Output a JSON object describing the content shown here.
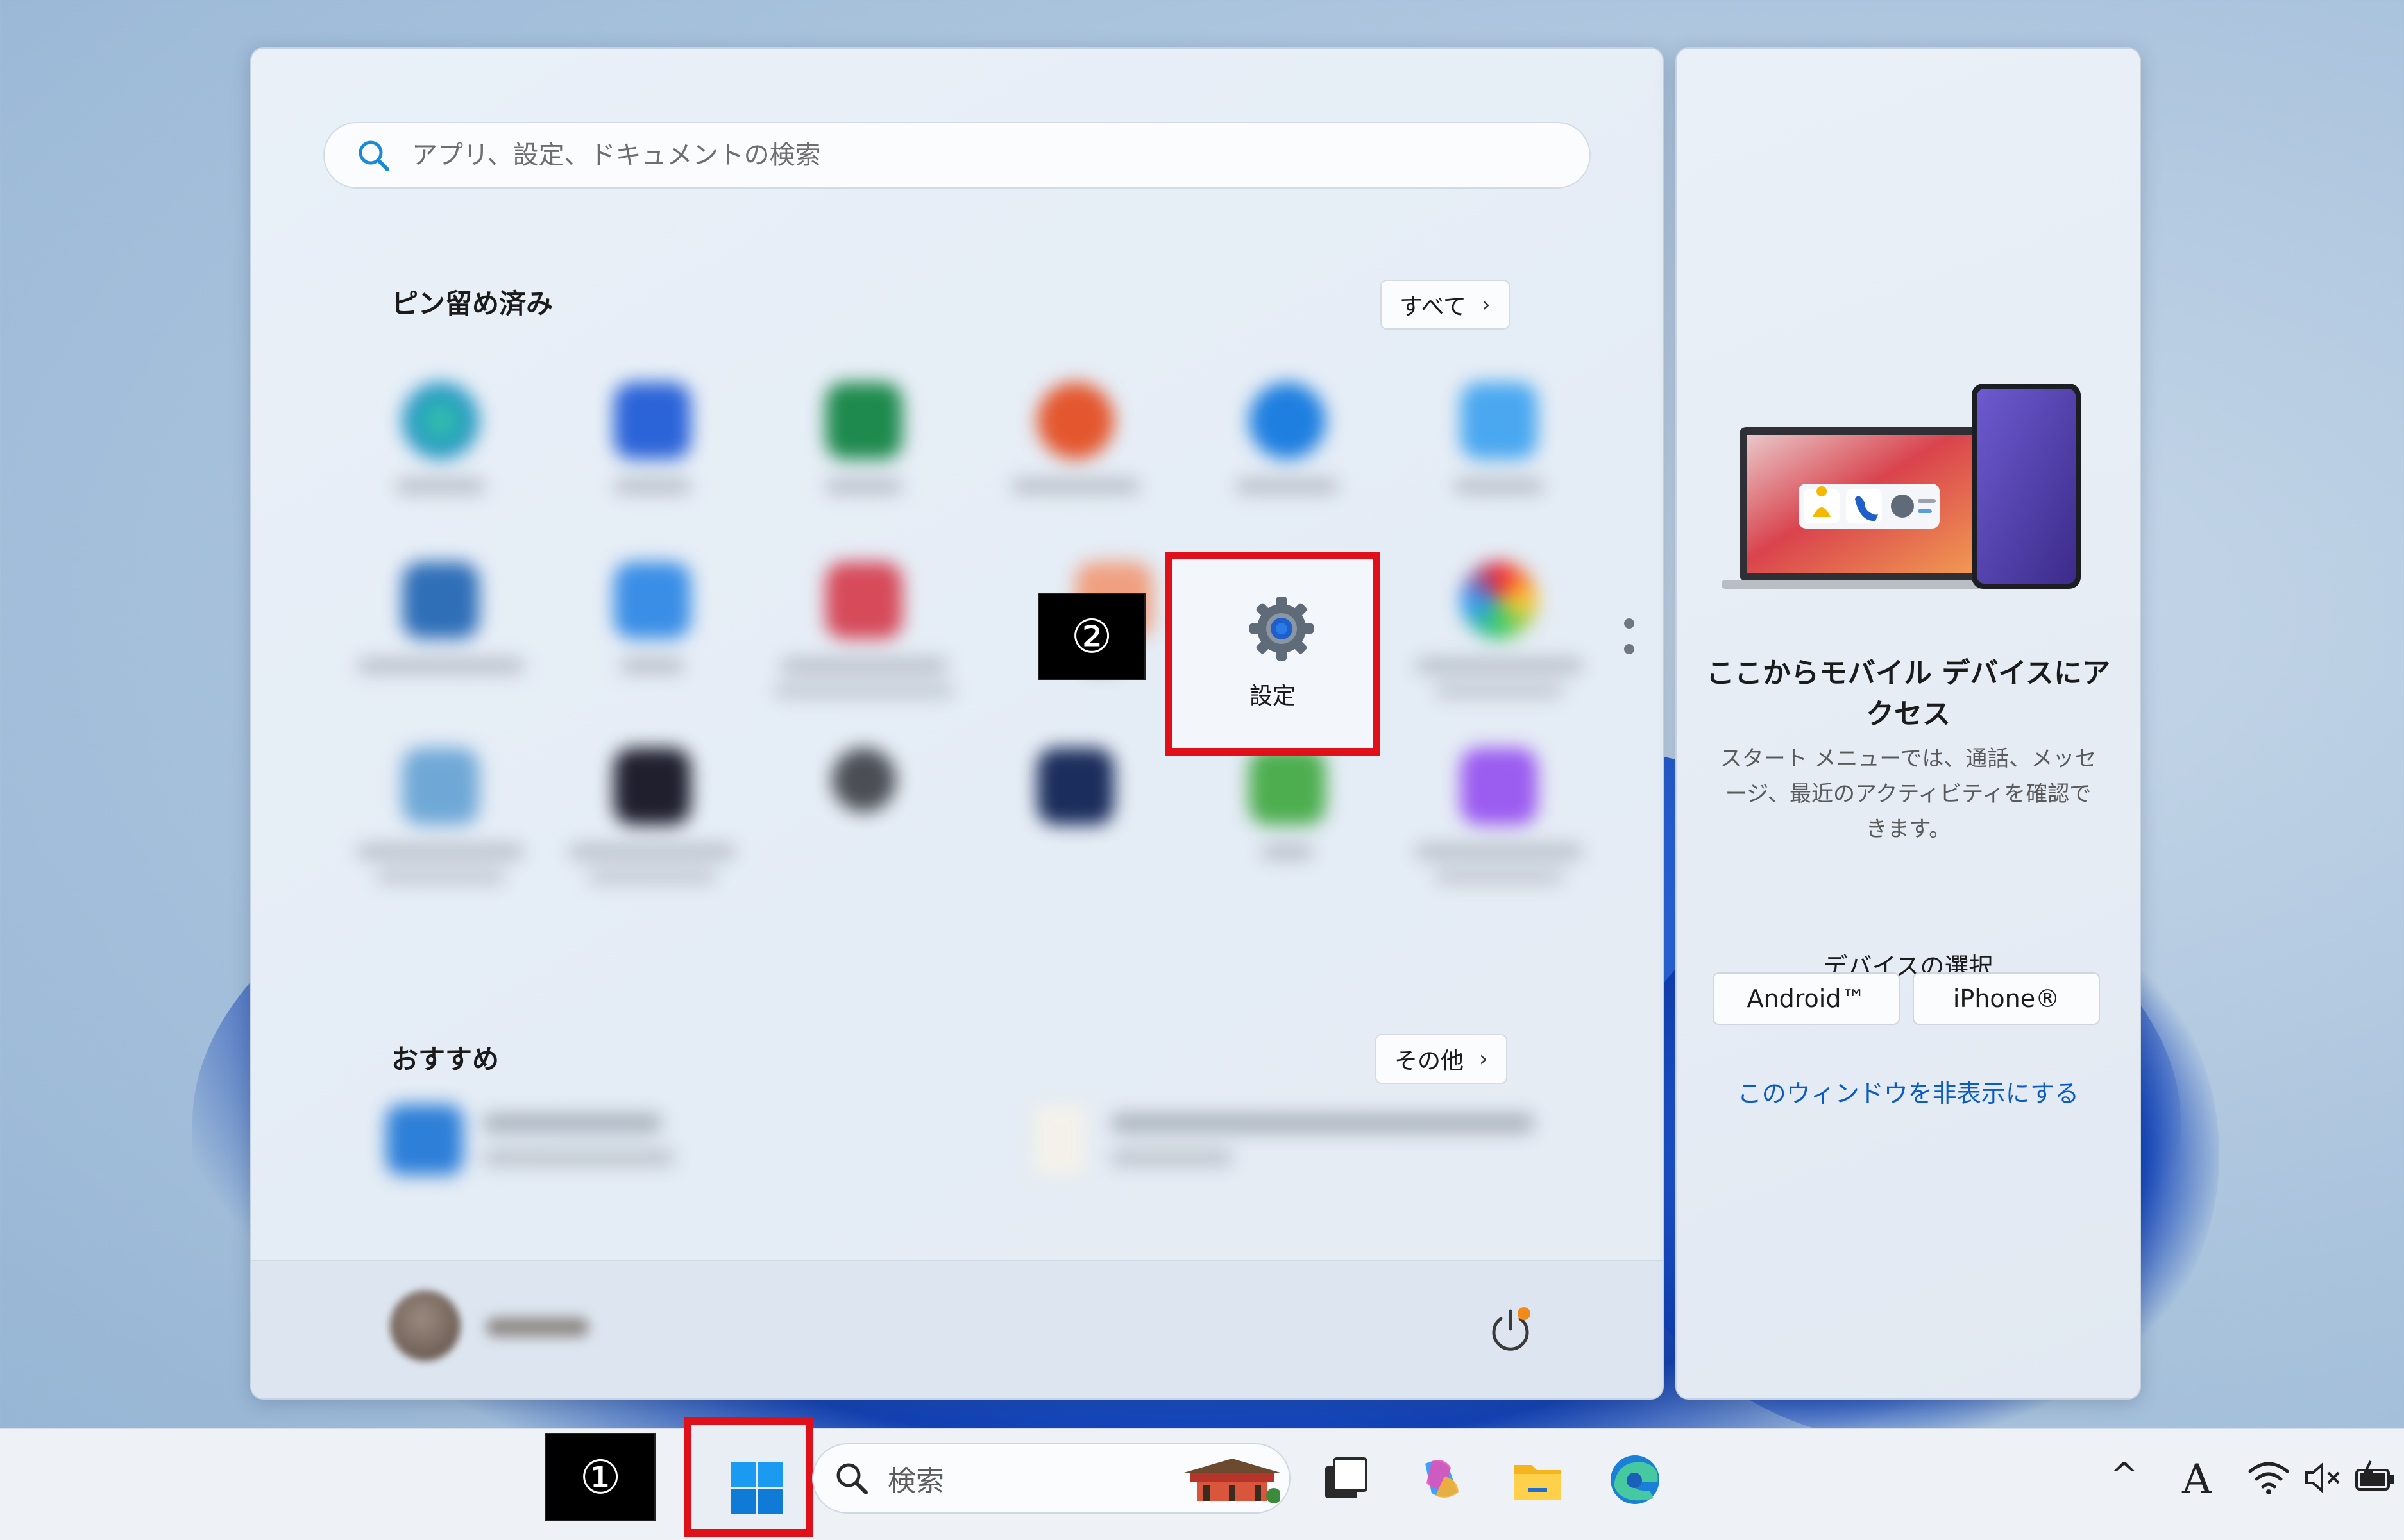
{
  "start_menu": {
    "search": {
      "placeholder": "アプリ、設定、ドキュメントの検索"
    },
    "pinned": {
      "title": "ピン留め済み",
      "all_button": "すべて",
      "chevron": "›"
    },
    "settings_tile": {
      "label": "設定",
      "icon": "gear-icon"
    },
    "recommended": {
      "title": "おすすめ",
      "more_button": "その他",
      "chevron": "›"
    },
    "power_icon": "power-icon"
  },
  "companion": {
    "title": "ここからモバイル デバイスにアクセス",
    "description": "スタート メニューでは、通話、メッセージ、最近のアクティビティを確認できます。",
    "device_prompt": "デバイスの選択",
    "android_button": "Android™",
    "iphone_button": "iPhone®",
    "hide_link": "このウィンドウを非表示にする"
  },
  "annotations": {
    "step1": "①",
    "step2": "②"
  },
  "taskbar": {
    "search_label": "検索",
    "tray": {
      "chevron": "^",
      "ime": "A"
    }
  },
  "colors": {
    "highlight": "#e0101a",
    "accent": "#0a5bc4"
  }
}
